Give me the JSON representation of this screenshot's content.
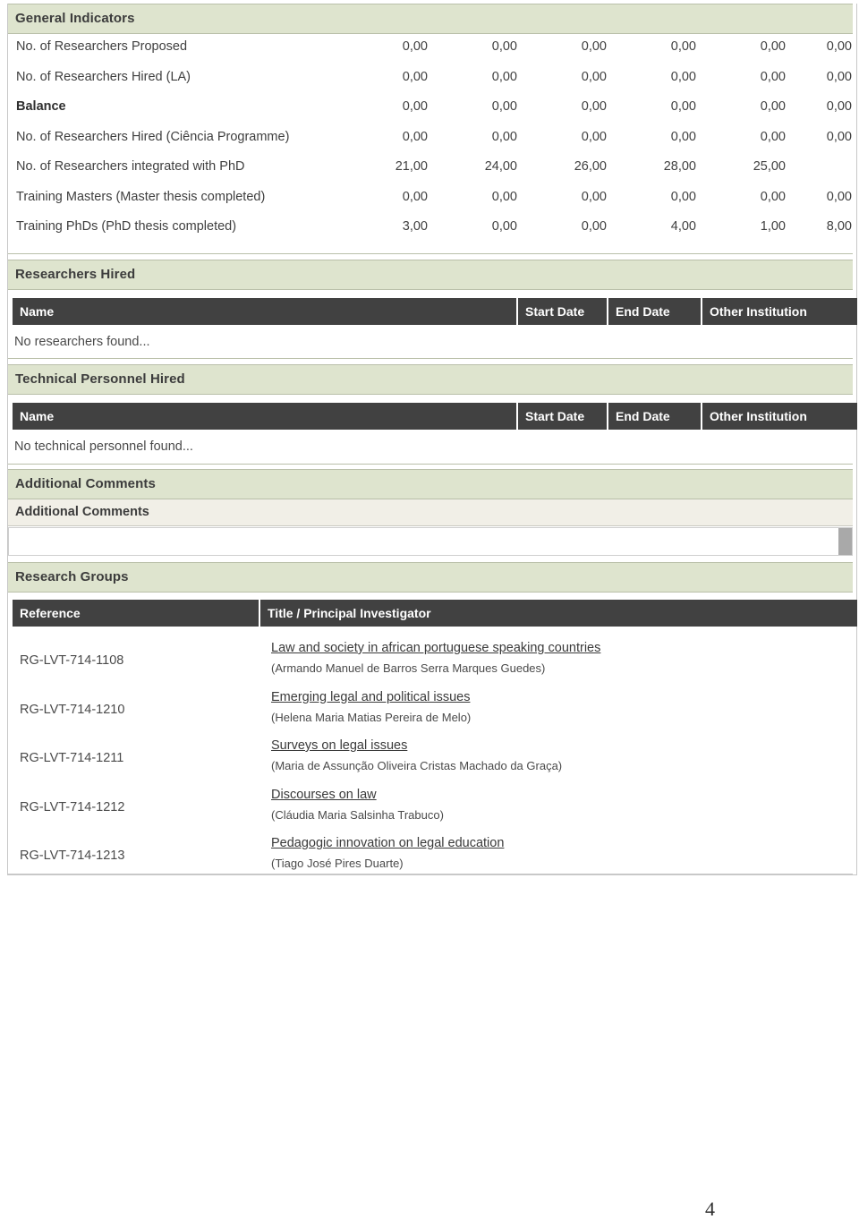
{
  "document": {
    "page_number": "4"
  },
  "sections": {
    "general_indicators": {
      "title": "General Indicators",
      "rows": [
        {
          "label": "No. of Researchers Proposed",
          "bold": false,
          "values": [
            "0,00",
            "0,00",
            "0,00",
            "0,00",
            "0,00",
            "0,00"
          ]
        },
        {
          "label": "No. of Researchers Hired (LA)",
          "bold": false,
          "values": [
            "0,00",
            "0,00",
            "0,00",
            "0,00",
            "0,00",
            "0,00"
          ]
        },
        {
          "label": "Balance",
          "bold": true,
          "values": [
            "0,00",
            "0,00",
            "0,00",
            "0,00",
            "0,00",
            "0,00"
          ]
        },
        {
          "label": "No. of Researchers Hired (Ciência Programme)",
          "bold": false,
          "values": [
            "0,00",
            "0,00",
            "0,00",
            "0,00",
            "0,00",
            "0,00"
          ]
        },
        {
          "label": "No. of Researchers integrated with PhD",
          "bold": false,
          "values": [
            "21,00",
            "24,00",
            "26,00",
            "28,00",
            "25,00",
            ""
          ]
        },
        {
          "label": "Training Masters (Master thesis completed)",
          "bold": false,
          "values": [
            "0,00",
            "0,00",
            "0,00",
            "0,00",
            "0,00",
            "0,00"
          ]
        },
        {
          "label": "Training PhDs (PhD thesis completed)",
          "bold": false,
          "values": [
            "3,00",
            "0,00",
            "0,00",
            "4,00",
            "1,00",
            "8,00"
          ]
        }
      ]
    },
    "researchers_hired": {
      "title": "Researchers Hired",
      "columns": [
        "Name",
        "Start Date",
        "End Date",
        "Other Institution"
      ],
      "empty_message": "No researchers found..."
    },
    "technical_personnel_hired": {
      "title": "Technical Personnel Hired",
      "columns": [
        "Name",
        "Start Date",
        "End Date",
        "Other Institution"
      ],
      "empty_message": "No technical personnel found..."
    },
    "additional_comments": {
      "title": "Additional Comments",
      "field_label": "Additional Comments",
      "value": ""
    },
    "research_groups": {
      "title": "Research Groups",
      "columns": [
        "Reference",
        "Title / Principal Investigator"
      ],
      "rows": [
        {
          "reference": "RG-LVT-714-1108",
          "title": "Law and society in african portuguese speaking countries",
          "investigator": "(Armando Manuel de Barros Serra Marques Guedes)"
        },
        {
          "reference": "RG-LVT-714-1210",
          "title": "Emerging legal and political issues",
          "investigator": "(Helena Maria Matias Pereira de Melo)"
        },
        {
          "reference": "RG-LVT-714-1211",
          "title": "Surveys on legal issues",
          "investigator": "(Maria de Assunção Oliveira Cristas Machado da Graça)"
        },
        {
          "reference": "RG-LVT-714-1212",
          "title": "Discourses on law",
          "investigator": "(Cláudia Maria Salsinha Trabuco)"
        },
        {
          "reference": "RG-LVT-714-1213",
          "title": "Pedagogic innovation on legal education",
          "investigator": "(Tiago José Pires Duarte)"
        }
      ]
    }
  },
  "colors": {
    "band_background": "#dee4ce",
    "band_border": "#b9bfa9",
    "table_header_background": "#414141",
    "subfield_background": "#f1efe7",
    "scrollbar": "#a9a9a9"
  }
}
